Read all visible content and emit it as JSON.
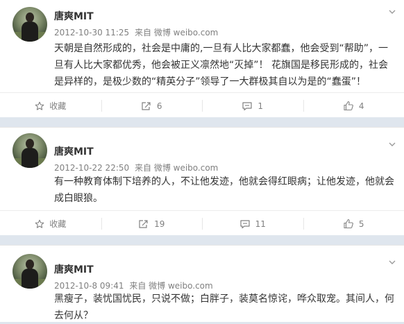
{
  "posts": [
    {
      "username": "唐爽MIT",
      "time": "2012-10-30 11:25",
      "source_prefix": "来自",
      "source": "微博 weibo.com",
      "text": "天朝是自然形成的，社会是中庸的,一旦有人比大家都蠢，他会受到“帮助”，一旦有人比大家都优秀，他会被正义凛然地“灭掉”！ 花旗国是移民形成的，社会是异样的，是极少数的“精英分子”领导了一大群极其自以为是的“蠢蛋”！",
      "actions": {
        "favorite": "收藏",
        "repost": "6",
        "comment": "1",
        "like": "4"
      }
    },
    {
      "username": "唐爽MIT",
      "time": "2012-10-22 22:50",
      "source_prefix": "来自",
      "source": "微博 weibo.com",
      "text": "有一种教育体制下培养的人，不让他发迹，他就会得红眼病；让他发迹，他就会成白眼狼。",
      "actions": {
        "favorite": "收藏",
        "repost": "19",
        "comment": "11",
        "like": "5"
      }
    },
    {
      "username": "唐爽MIT",
      "time": "2012-10-8 09:41",
      "source_prefix": "来自",
      "source": "微博 weibo.com",
      "text": "黑瘦子，装忧国忧民，只说不做；白胖子，装莫名惊诧，哗众取宠。其间人，何去何从？"
    }
  ],
  "icons": {
    "favorite": "star-icon",
    "repost": "repost-icon",
    "comment": "comment-icon",
    "like": "thumbs-up-icon",
    "menu": "chevron-down-icon"
  },
  "colors": {
    "page_background": "#dfe6ee",
    "card_background": "#ffffff",
    "text": "#333333",
    "meta_text": "#808080"
  }
}
